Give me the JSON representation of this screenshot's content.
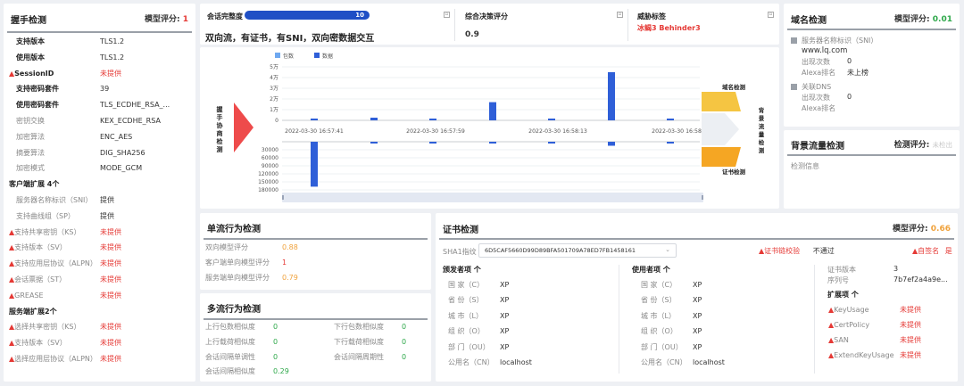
{
  "handshake": {
    "title": "握手检测",
    "score_label": "模型评分:",
    "score": "1",
    "rows": [
      {
        "k": "支持版本",
        "v": "TLS1.2",
        "style": "bold",
        "warn": false,
        "vred": false
      },
      {
        "k": "使用版本",
        "v": "TLS1.2",
        "style": "bold",
        "warn": false,
        "vred": false
      },
      {
        "k": "SessionID",
        "v": "未提供",
        "style": "bold",
        "warn": true,
        "vred": true
      },
      {
        "k": "支持密码套件",
        "v": "39",
        "style": "bold",
        "warn": false,
        "vred": false
      },
      {
        "k": "使用密码套件",
        "v": "TLS_ECDHE_RSA_...",
        "style": "bold",
        "warn": false,
        "vred": false
      },
      {
        "k": "密钥交换",
        "v": "KEX_ECDHE_RSA",
        "style": "gray",
        "warn": false,
        "vred": false
      },
      {
        "k": "加密算法",
        "v": "ENC_AES",
        "style": "gray",
        "warn": false,
        "vred": false
      },
      {
        "k": "摘要算法",
        "v": "DIG_SHA256",
        "style": "gray",
        "warn": false,
        "vred": false
      },
      {
        "k": "加密模式",
        "v": "MODE_GCM",
        "style": "gray",
        "warn": false,
        "vred": false
      }
    ],
    "client_ext_title": "客户端扩展 4个",
    "client_ext": [
      {
        "k": "服务器名称标识（SNI）",
        "v": "提供",
        "warn": false,
        "vred": false
      },
      {
        "k": "支持曲线组（SP）",
        "v": "提供",
        "warn": false,
        "vred": false
      },
      {
        "k": "支持共享密钥（KS）",
        "v": "未提供",
        "warn": true,
        "vred": true
      },
      {
        "k": "支持版本（SV）",
        "v": "未提供",
        "warn": true,
        "vred": true
      },
      {
        "k": "支持应用层协议（ALPN）",
        "v": "未提供",
        "warn": true,
        "vred": true
      },
      {
        "k": "会话票据（ST）",
        "v": "未提供",
        "warn": true,
        "vred": true
      },
      {
        "k": "GREASE",
        "v": "未提供",
        "warn": true,
        "vred": true
      }
    ],
    "server_ext_title": "服务端扩展2个",
    "server_ext": [
      {
        "k": "选择共享密钥（KS）",
        "v": "未提供",
        "warn": true,
        "vred": true
      },
      {
        "k": "支持版本（SV）",
        "v": "未提供",
        "warn": true,
        "vred": true
      },
      {
        "k": "选择应用层协议（ALPN）",
        "v": "未提供",
        "warn": true,
        "vred": true
      }
    ]
  },
  "session": {
    "label": "会话完整度",
    "progress_value": "10",
    "progress_fraction": 1.0,
    "description": "双向流，有证书，有SNI，双向密数据交互",
    "decision_label": "综合决策评分",
    "decision_value": "0.9",
    "threat_label": "威胁标签",
    "threat_value": "冰蝎3 Behinder3"
  },
  "chart_data": {
    "type": "bar",
    "legend": [
      "包数",
      "数据"
    ],
    "legend_colors": [
      "#6fa8f0",
      "#2f5fd8"
    ],
    "upper_ticks": [
      "5万",
      "4万",
      "3万",
      "2万",
      "1万",
      "0"
    ],
    "lower_ticks": [
      "30000",
      "60000",
      "90000",
      "120000",
      "150000",
      "180000"
    ],
    "x_ticks": [
      "2022-03-30 16:57:41",
      "2022-03-30 16:57:59",
      "2022-03-30 16:58:13",
      "2022-03-30 16:58:33"
    ],
    "left_label": "握手协商检测",
    "series": [
      {
        "name": "上行",
        "values": [
          1500,
          2500,
          1000,
          17000,
          1200,
          45000,
          1200
        ]
      },
      {
        "name": "下行",
        "values": [
          168000,
          2000,
          1000,
          3000,
          2000,
          15000,
          2000
        ]
      }
    ]
  },
  "flow": {
    "domain_label": "域名检测",
    "cert_label": "证书检测",
    "bg_label": "背景流量检测"
  },
  "single_flow": {
    "title": "单流行为检测",
    "rows": [
      {
        "k": "双向模型评分",
        "v": "0.88",
        "color": "orange"
      },
      {
        "k": "客户端单向模型评分",
        "v": "1",
        "color": "red"
      },
      {
        "k": "服务端单向模型评分",
        "v": "0.79",
        "color": "orange"
      }
    ]
  },
  "multi_flow": {
    "title": "多流行为检测",
    "left": [
      {
        "k": "上行包数相似度",
        "v": "0"
      },
      {
        "k": "上行载荷相似度",
        "v": "0"
      },
      {
        "k": "会话间隔单调性",
        "v": "0"
      },
      {
        "k": "会话间隔相似度",
        "v": "0.29"
      }
    ],
    "right": [
      {
        "k": "下行包数相似度",
        "v": "0"
      },
      {
        "k": "下行载荷相似度",
        "v": "0"
      },
      {
        "k": "会话间隔周期性",
        "v": "0"
      }
    ]
  },
  "cert": {
    "title": "证书检测",
    "score_label": "模型评分:",
    "score": "0.66",
    "sha1_label": "SHA1指纹",
    "sha1_value": "6D5CAF5660D99D89BFA501709A78ED7FB1458161",
    "chain_label": "证书链校验",
    "chain_value": "不通过",
    "self_signed_label": "自签名",
    "self_signed_value": "是",
    "issuer_title": "颁发者项 个",
    "issuer": [
      {
        "k": "国 家（C）",
        "v": "XP"
      },
      {
        "k": "省 份（S）",
        "v": "XP"
      },
      {
        "k": "城 市（L）",
        "v": "XP"
      },
      {
        "k": "组 织（O）",
        "v": "XP"
      },
      {
        "k": "部 门（OU）",
        "v": "XP"
      },
      {
        "k": "公用名（CN）",
        "v": "localhost"
      }
    ],
    "user_title": "使用者项 个",
    "user": [
      {
        "k": "国 家（C）",
        "v": "XP"
      },
      {
        "k": "省 份（S）",
        "v": "XP"
      },
      {
        "k": "城 市（L）",
        "v": "XP"
      },
      {
        "k": "组 织（O）",
        "v": "XP"
      },
      {
        "k": "部 门（OU）",
        "v": "XP"
      },
      {
        "k": "公用名（CN）",
        "v": "localhost"
      }
    ],
    "version_label": "证书版本",
    "version_value": "3",
    "serial_label": "序列号",
    "serial_value": "7b7ef2a4a9e...",
    "ext_title": "扩展项 个",
    "ext": [
      {
        "k": "KeyUsage",
        "v": "未提供"
      },
      {
        "k": "CertPolicy",
        "v": "未提供"
      },
      {
        "k": "SAN",
        "v": "未提供"
      },
      {
        "k": "ExtendKeyUsage",
        "v": "未提供"
      }
    ]
  },
  "domain": {
    "title": "域名检测",
    "score_label": "模型评分:",
    "score": "0.01",
    "sni_label": "服务器名称标识（SNI）",
    "sni_value": "www.lq.com",
    "count_label": "出现次数",
    "count_value": "0",
    "alexa_label": "Alexa排名",
    "alexa_value": "未上榜",
    "dns_label": "关联DNS",
    "dns_count_label": "出现次数",
    "dns_count_value": "0",
    "dns_alexa_label": "Alexa排名"
  },
  "bgflow": {
    "title": "背景流量检测",
    "score_label": "检测评分:",
    "score": "未检出",
    "info_label": "检测信息"
  }
}
